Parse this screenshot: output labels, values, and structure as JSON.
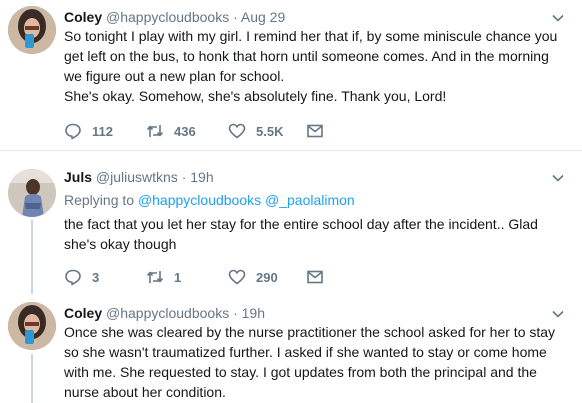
{
  "tweets": [
    {
      "name": "Coley",
      "handle": "@happycloudbooks",
      "date": "· Aug 29",
      "text": "So tonight I play with my girl. I remind her that if, by some miniscule chance you get left on the bus, to honk that horn until someone comes. And in the morning we figure out a new plan for school.\nShe's okay. Somehow, she's absolutely fine. Thank you, Lord!",
      "replies": "112",
      "retweets": "436",
      "likes": "5.5K"
    },
    {
      "name": "Juls",
      "handle": "@juliuswtkns",
      "date": "· 19h",
      "reply_prefix": "Replying to",
      "reply_mentions": "@happycloudbooks @_paolalimon",
      "text": "the fact that you let her stay for the entire school day after the incident.. Glad she's okay though",
      "replies": "3",
      "retweets": "1",
      "likes": "290"
    },
    {
      "name": "Coley",
      "handle": "@happycloudbooks",
      "date": "· 19h",
      "text": "Once she was cleared by the nurse practitioner the school asked for her to stay so she wasn't traumatized further. I asked if she wanted to stay or come home with me. She requested to stay. I got updates from both the principal and the nurse about her condition."
    }
  ],
  "icons": {
    "reply": "reply-icon",
    "retweet": "retweet-icon",
    "like": "heart-icon",
    "message": "envelope-icon",
    "menu": "chevron-down-icon"
  },
  "colors": {
    "link": "#1da1f2",
    "meta": "#657786",
    "divider": "#e6ecf0",
    "thread_line": "#ccd6dd"
  }
}
